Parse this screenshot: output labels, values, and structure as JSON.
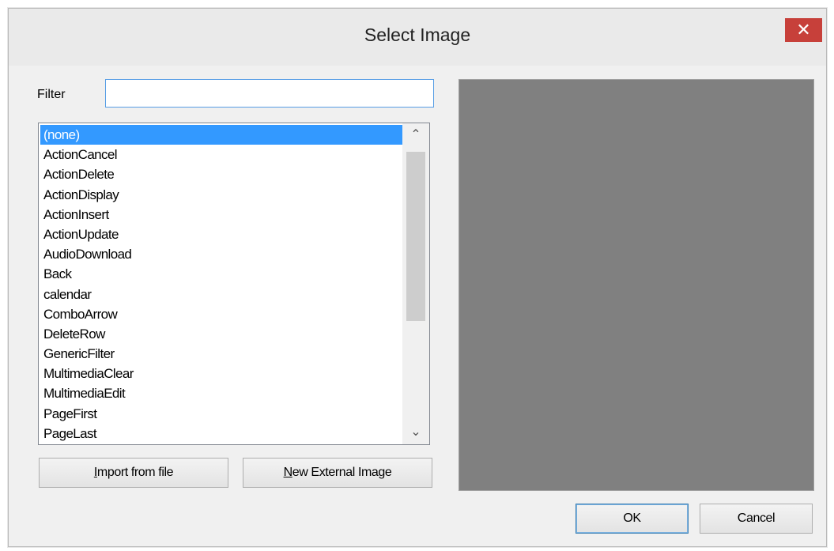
{
  "window": {
    "title": "Select Image",
    "close_glyph": "✕"
  },
  "filter": {
    "label": "Filter",
    "value": "",
    "placeholder": ""
  },
  "list": {
    "items": [
      "(none)",
      "ActionCancel",
      "ActionDelete",
      "ActionDisplay",
      "ActionInsert",
      "ActionUpdate",
      "AudioDownload",
      "Back",
      "calendar",
      "ComboArrow",
      "DeleteRow",
      "GenericFilter",
      "MultimediaClear",
      "MultimediaEdit",
      "PageFirst",
      "PageLast"
    ],
    "selected": "(none)",
    "scroll_up_glyph": "⌃",
    "scroll_down_glyph": "⌄"
  },
  "buttons": {
    "import_mnemonic": "I",
    "import_rest": "mport from file",
    "external_mnemonic": "N",
    "external_rest": "ew External Image",
    "ok": "OK",
    "cancel": "Cancel"
  },
  "colors": {
    "selection": "#3399ff",
    "close": "#c7403a",
    "preview": "#808080",
    "focus_border": "#569de5"
  }
}
